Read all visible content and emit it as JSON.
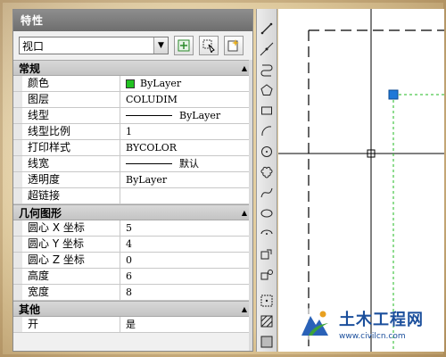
{
  "palette": {
    "title": "特性",
    "selector": {
      "value": "视口"
    }
  },
  "sections": [
    {
      "title": "常规",
      "rows": [
        {
          "name": "颜色",
          "value": "ByLayer",
          "kind": "color",
          "color": "#22c322"
        },
        {
          "name": "图层",
          "value": "COLUDIM"
        },
        {
          "name": "线型",
          "value": "ByLayer",
          "kind": "line"
        },
        {
          "name": "线型比例",
          "value": "1"
        },
        {
          "name": "打印样式",
          "value": "BYCOLOR"
        },
        {
          "name": "线宽",
          "value": "默认",
          "kind": "line"
        },
        {
          "name": "透明度",
          "value": "ByLayer"
        },
        {
          "name": "超链接",
          "value": ""
        }
      ]
    },
    {
      "title": "几何图形",
      "rows": [
        {
          "name": "圆心 X 坐标",
          "value": "5"
        },
        {
          "name": "圆心 Y 坐标",
          "value": "4"
        },
        {
          "name": "圆心 Z 坐标",
          "value": "0"
        },
        {
          "name": "高度",
          "value": "6"
        },
        {
          "name": "宽度",
          "value": "8"
        }
      ]
    },
    {
      "title": "其他",
      "rows": [
        {
          "name": "开",
          "value": "是"
        }
      ]
    }
  ],
  "toolbar": {
    "icons": [
      "line-icon",
      "construction-line-icon",
      "polyline-icon",
      "polygon-icon",
      "rectangle-icon",
      "arc-icon",
      "circle-icon",
      "revision-cloud-icon",
      "spline-icon",
      "ellipse-icon",
      "ellipse-arc-icon",
      "insert-block-icon",
      "make-block-icon",
      "point-icon",
      "hatch-icon",
      "gradient-icon",
      "region-icon"
    ]
  },
  "watermark": {
    "title": "土木工程网",
    "url": "www.civilcn.com"
  },
  "colors": {
    "grip": "#1e78d8",
    "dashed_green": "#22b822"
  }
}
